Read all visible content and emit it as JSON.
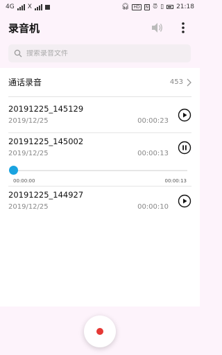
{
  "status_bar": {
    "left_indicators": [
      "4G",
      "X"
    ],
    "right_indicators": [
      "headset",
      "HD",
      "N",
      "alarm",
      "vibrate"
    ],
    "time": "21:18"
  },
  "app_bar": {
    "title": "录音机",
    "icons": [
      "volume-icon",
      "more-icon"
    ]
  },
  "search": {
    "placeholder": "搜索录音文件",
    "value": ""
  },
  "call_recordings": {
    "label": "通话录音",
    "count": "453"
  },
  "recordings": [
    {
      "name": "20191225_145129",
      "date": "2019/12/25",
      "duration": "00:00:23",
      "state": "play"
    },
    {
      "name": "20191225_145002",
      "date": "2019/12/25",
      "duration": "00:00:13",
      "state": "pause"
    },
    {
      "name": "20191225_144927",
      "date": "2019/12/25",
      "duration": "00:00:10",
      "state": "play"
    }
  ],
  "player": {
    "current_time": "00:00:00",
    "total_time": "00:00:13",
    "progress": 0.0
  },
  "colors": {
    "accent": "#1aa3e0",
    "record": "#e53935",
    "background": "#fdf3fb"
  }
}
